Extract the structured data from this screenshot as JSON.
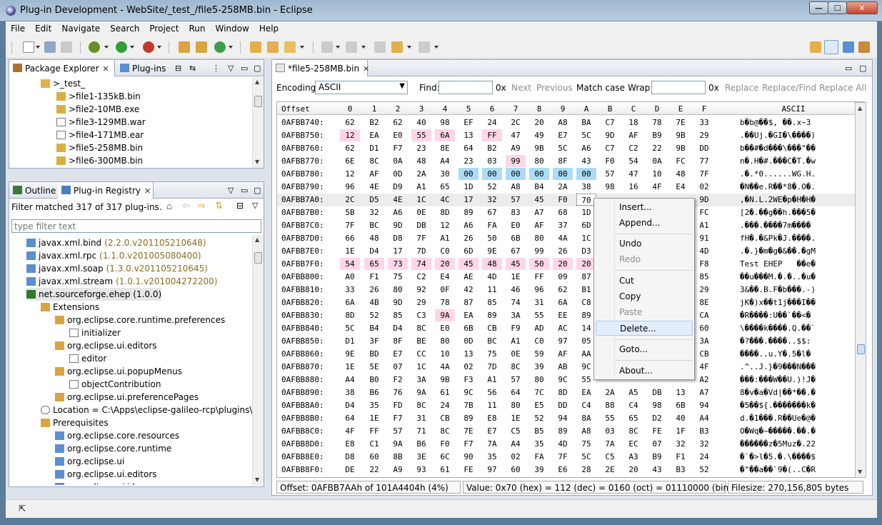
{
  "window": {
    "title": "Plug-in Development - WebSite/_test_/file5-258MB.bin - Eclipse",
    "min": "—",
    "max": "☐",
    "close": "✕"
  },
  "menu": [
    "File",
    "Edit",
    "Navigate",
    "Search",
    "Project",
    "Run",
    "Window",
    "Help"
  ],
  "left_top": {
    "tabs": [
      {
        "label": "Package Explorer",
        "close": "✕"
      },
      {
        "label": "Plug-ins"
      }
    ],
    "tree": [
      {
        "label": ">_test_",
        "indent": 44,
        "icon": "folder"
      },
      {
        "label": ">file1-135kB.bin",
        "indent": 66,
        "icon": "bin"
      },
      {
        "label": ">file2-10MB.exe",
        "indent": 66,
        "icon": "bin"
      },
      {
        "label": ">file3-129MB.war",
        "indent": 66,
        "icon": "file"
      },
      {
        "label": ">file4-171MB.ear",
        "indent": 66,
        "icon": "file"
      },
      {
        "label": ">file5-258MB.bin",
        "indent": 66,
        "icon": "bin"
      },
      {
        "label": ">file6-300MB.bin",
        "indent": 66,
        "icon": "bin"
      }
    ]
  },
  "left_bottom": {
    "tabs": [
      {
        "label": "Outline"
      },
      {
        "label": "Plug-in Registry",
        "close": "✕"
      }
    ],
    "filter_status": "Filter matched 317 of 317 plug-ins.",
    "filter_placeholder": "type filter text",
    "tree": [
      {
        "label": "javax.xml.bind",
        "ver": "(2.2.0.v201105210648)",
        "indent": 24,
        "icon": "plugin"
      },
      {
        "label": "javax.xml.rpc",
        "ver": "(1.1.0.v201005080400)",
        "indent": 24,
        "icon": "plugin"
      },
      {
        "label": "javax.xml.soap",
        "ver": "(1.3.0.v201105210645)",
        "indent": 24,
        "icon": "plugin"
      },
      {
        "label": "javax.xml.stream",
        "ver": "(1.0.1.v201004272200)",
        "indent": 24,
        "icon": "plugin"
      },
      {
        "label": "net.sourceforge.ehep (1.0.0)",
        "ver": "",
        "indent": 24,
        "icon": "plugin-active"
      },
      {
        "label": "Extensions",
        "ver": "",
        "indent": 44,
        "icon": "ext"
      },
      {
        "label": "org.eclipse.core.runtime.preferences",
        "ver": "",
        "indent": 64,
        "icon": "ext"
      },
      {
        "label": "initializer",
        "ver": "",
        "indent": 84,
        "icon": "x"
      },
      {
        "label": "org.eclipse.ui.editors",
        "ver": "",
        "indent": 64,
        "icon": "ext"
      },
      {
        "label": "editor",
        "ver": "",
        "indent": 84,
        "icon": "x"
      },
      {
        "label": "org.eclipse.ui.popupMenus",
        "ver": "",
        "indent": 64,
        "icon": "ext"
      },
      {
        "label": "objectContribution",
        "ver": "",
        "indent": 84,
        "icon": "x"
      },
      {
        "label": "org.eclipse.ui.preferencePages",
        "ver": "",
        "indent": 64,
        "icon": "ext"
      },
      {
        "label": "Location = C:\\Apps\\eclipse-galileo-rcp\\plugins\\net.s",
        "ver": "",
        "indent": 44,
        "icon": "at"
      },
      {
        "label": "Prerequisites",
        "ver": "",
        "indent": 44,
        "icon": "ext"
      },
      {
        "label": "org.eclipse.core.resources",
        "ver": "",
        "indent": 64,
        "icon": "plugin"
      },
      {
        "label": "org.eclipse.core.runtime",
        "ver": "",
        "indent": 64,
        "icon": "plugin"
      },
      {
        "label": "org.eclipse.ui",
        "ver": "",
        "indent": 64,
        "icon": "plugin"
      },
      {
        "label": "org.eclipse.ui.editors",
        "ver": "",
        "indent": 64,
        "icon": "plugin"
      },
      {
        "label": "org.eclipse.ui.ide",
        "ver": "",
        "indent": 64,
        "icon": "plugin"
      }
    ]
  },
  "editor": {
    "tab": {
      "label": "*file5-258MB.bin",
      "close": "✕"
    },
    "encoding_label": "Encoding:",
    "encoding_value": "ASCII",
    "find_label": "Find:",
    "ox1": "0x",
    "next": "Next",
    "previous": "Previous",
    "match_case": "Match case",
    "wrap": "Wrap",
    "ox2": "0x",
    "replace": "Replace",
    "replace_find": "Replace/Find",
    "replace_all": "Replace All",
    "header": [
      "Offset",
      "0",
      "1",
      "2",
      "3",
      "4",
      "5",
      "6",
      "7",
      "8",
      "9",
      "A",
      "B",
      "C",
      "D",
      "E",
      "F",
      "ASCII"
    ],
    "rows": [
      {
        "off": "0AFBB740:",
        "bytes": [
          "62",
          "B2",
          "62",
          "40",
          "98",
          "EF",
          "24",
          "2C",
          "20",
          "A8",
          "BA",
          "C7",
          "18",
          "78",
          "7E",
          "33"
        ],
        "ascii": "b�b@��$, ��.x~3"
      },
      {
        "off": "0AFBB750:",
        "bytes": [
          "12",
          "EA",
          "E0",
          "55",
          "6A",
          "13",
          "FF",
          "47",
          "49",
          "E7",
          "5C",
          "9D",
          "AF",
          "B9",
          "9B",
          "29"
        ],
        "ascii": ".��Uj.�GI�\\����)"
      },
      {
        "off": "0AFBB760:",
        "bytes": [
          "62",
          "D1",
          "F7",
          "23",
          "8E",
          "64",
          "B2",
          "A9",
          "9B",
          "5C",
          "A6",
          "C7",
          "C2",
          "22",
          "9B",
          "DD"
        ],
        "ascii": "b��#�d���\\���\"��"
      },
      {
        "off": "0AFBB770:",
        "bytes": [
          "6E",
          "8C",
          "0A",
          "48",
          "A4",
          "23",
          "03",
          "99",
          "80",
          "8F",
          "43",
          "F0",
          "54",
          "0A",
          "FC",
          "77"
        ],
        "ascii": "n�.H�#.���C�T.�w"
      },
      {
        "off": "0AFBB780:",
        "bytes": [
          "12",
          "AF",
          "0D",
          "2A",
          "30",
          "00",
          "00",
          "00",
          "00",
          "00",
          "00",
          "57",
          "47",
          "10",
          "48",
          "7F"
        ],
        "ascii": ".�.*0......WG.H."
      },
      {
        "off": "0AFBB790:",
        "bytes": [
          "96",
          "4E",
          "D9",
          "A1",
          "65",
          "1D",
          "52",
          "A8",
          "B4",
          "2A",
          "38",
          "98",
          "16",
          "4F",
          "E4",
          "02"
        ],
        "ascii": "�N��e.R��*8�.O�."
      },
      {
        "off": "0AFBB7A0:",
        "bytes": [
          "2C",
          "D5",
          "4E",
          "1C",
          "4C",
          "17",
          "32",
          "57",
          "45",
          "F0",
          "70",
          "",
          "",
          "",
          "",
          "9D"
        ],
        "ascii": ",�N.L.2WE�p�H�H�"
      },
      {
        "off": "0AFBB7B0:",
        "bytes": [
          "5B",
          "32",
          "A6",
          "0E",
          "8D",
          "89",
          "67",
          "83",
          "A7",
          "68",
          "1D",
          "",
          "",
          "",
          "",
          "FC"
        ],
        "ascii": "[2�.��g��h.���5�"
      },
      {
        "off": "0AFBB7C0:",
        "bytes": [
          "7F",
          "BC",
          "9D",
          "DB",
          "12",
          "A6",
          "FA",
          "E0",
          "AF",
          "37",
          "6D",
          "",
          "",
          "",
          "",
          "A1"
        ],
        "ascii": ".���.����7m����"
      },
      {
        "off": "0AFBB7D0:",
        "bytes": [
          "66",
          "48",
          "D8",
          "7F",
          "A1",
          "26",
          "50",
          "6B",
          "80",
          "4A",
          "1C",
          "",
          "",
          "",
          "",
          "91"
        ],
        "ascii": "fH�.�&Pk�J.����."
      },
      {
        "off": "0AFBB7E0:",
        "bytes": [
          "1E",
          "D4",
          "17",
          "7D",
          "C0",
          "6D",
          "9E",
          "67",
          "99",
          "26",
          "D3",
          "",
          "",
          "",
          "",
          "4D"
        ],
        "ascii": ".�.}�m�g�&��.�gM"
      },
      {
        "off": "0AFBB7F0:",
        "bytes": [
          "54",
          "65",
          "73",
          "74",
          "20",
          "45",
          "48",
          "45",
          "50",
          "20",
          "20",
          "",
          "",
          "",
          "",
          "F8"
        ],
        "ascii": "Test EHEP   ��e�"
      },
      {
        "off": "0AFBB800:",
        "bytes": [
          "A0",
          "F1",
          "75",
          "C2",
          "E4",
          "AE",
          "4D",
          "1E",
          "FF",
          "09",
          "87",
          "",
          "",
          "",
          "",
          "85"
        ],
        "ascii": "��u���M.�.�..�u�"
      },
      {
        "off": "0AFBB810:",
        "bytes": [
          "33",
          "26",
          "80",
          "92",
          "0F",
          "42",
          "11",
          "46",
          "96",
          "62",
          "B1",
          "",
          "",
          "",
          "",
          "29"
        ],
        "ascii": "3&��.B.F�b���.-)"
      },
      {
        "off": "0AFBB820:",
        "bytes": [
          "6A",
          "4B",
          "9D",
          "29",
          "78",
          "87",
          "85",
          "74",
          "31",
          "6A",
          "C8",
          "",
          "",
          "",
          "",
          "8E"
        ],
        "ascii": "jK�)x��t1j���I��"
      },
      {
        "off": "0AFBB830:",
        "bytes": [
          "8D",
          "52",
          "85",
          "C3",
          "9A",
          "EA",
          "89",
          "3A",
          "55",
          "EE",
          "89",
          "",
          "",
          "",
          "",
          "CA"
        ],
        "ascii": "�R����:U��`��<�"
      },
      {
        "off": "0AFBB840:",
        "bytes": [
          "5C",
          "B4",
          "D4",
          "8C",
          "E0",
          "6B",
          "CB",
          "F9",
          "AD",
          "AC",
          "14",
          "",
          "",
          "",
          "",
          "60"
        ],
        "ascii": "\\����k����.Q.��`"
      },
      {
        "off": "0AFBB850:",
        "bytes": [
          "D1",
          "3F",
          "8F",
          "BE",
          "80",
          "0D",
          "BC",
          "A1",
          "C0",
          "97",
          "05",
          "",
          "",
          "",
          "",
          "3A"
        ],
        "ascii": "�?���.����..$$:"
      },
      {
        "off": "0AFBB860:",
        "bytes": [
          "9E",
          "BD",
          "E7",
          "CC",
          "10",
          "13",
          "75",
          "0E",
          "59",
          "AF",
          "AA",
          "",
          "",
          "",
          "",
          "CB"
        ],
        "ascii": "����..u.Y�.5�l�"
      },
      {
        "off": "0AFBB870:",
        "bytes": [
          "1E",
          "5E",
          "07",
          "1C",
          "4A",
          "02",
          "7D",
          "8C",
          "39",
          "AB",
          "9C",
          "",
          "",
          "",
          "",
          "4F"
        ],
        "ascii": ".^..J.}�9���N���"
      },
      {
        "off": "0AFBB880:",
        "bytes": [
          "A4",
          "B0",
          "F2",
          "3A",
          "9B",
          "F3",
          "A1",
          "57",
          "80",
          "9C",
          "55",
          "",
          "",
          "",
          "",
          "A2"
        ],
        "ascii": "���:���W��U.)!J�"
      },
      {
        "off": "0AFBB890:",
        "bytes": [
          "38",
          "B6",
          "76",
          "9A",
          "61",
          "9C",
          "56",
          "64",
          "7C",
          "8D",
          "EA",
          "2A",
          "A5",
          "DB",
          "13",
          "A7"
        ],
        "ascii": "8�v�a�Vd|��*��.�"
      },
      {
        "off": "0AFBB8A0:",
        "bytes": [
          "D4",
          "35",
          "FD",
          "8C",
          "24",
          "7B",
          "11",
          "80",
          "E5",
          "DD",
          "C4",
          "88",
          "C4",
          "98",
          "6B",
          "94"
        ],
        "ascii": "�5��${.�������k�"
      },
      {
        "off": "0AFBB8B0:",
        "bytes": [
          "64",
          "1E",
          "F7",
          "31",
          "CB",
          "89",
          "E8",
          "1E",
          "52",
          "94",
          "8A",
          "55",
          "65",
          "D2",
          "40",
          "A4"
        ],
        "ascii": "d.�1���.R��Ue�@�"
      },
      {
        "off": "0AFBB8C0:",
        "bytes": [
          "4F",
          "FF",
          "57",
          "71",
          "8C",
          "7E",
          "E7",
          "C5",
          "B5",
          "89",
          "A8",
          "03",
          "8C",
          "FE",
          "1F",
          "B3"
        ],
        "ascii": "O�Wq�~�����.��.�"
      },
      {
        "off": "0AFBB8D0:",
        "bytes": [
          "E8",
          "C1",
          "9A",
          "B6",
          "F0",
          "F7",
          "7A",
          "A4",
          "35",
          "4D",
          "75",
          "7A",
          "EC",
          "07",
          "32",
          "32"
        ],
        "ascii": "������z�5Muz�.22"
      },
      {
        "off": "0AFBB8E0:",
        "bytes": [
          "D8",
          "60",
          "8B",
          "3E",
          "6C",
          "90",
          "35",
          "02",
          "FA",
          "7F",
          "5C",
          "C5",
          "A3",
          "B9",
          "F1",
          "24"
        ],
        "ascii": "�`�>l�5.�.\\����$"
      },
      {
        "off": "0AFBB8F0:",
        "bytes": [
          "DE",
          "22",
          "A9",
          "93",
          "61",
          "FE",
          "97",
          "60",
          "39",
          "E6",
          "28",
          "2E",
          "20",
          "43",
          "B3",
          "52"
        ],
        "ascii": "�\"��a��`9�(..C�R"
      }
    ],
    "status_offset": "Offset: 0AFBB7AAh of 101A4404h (4%)",
    "status_value": "Value: 0x70 (hex) = 112 (dec) = 0160 (oct) = 01110000 (bin)",
    "status_filesize": "Filesize: 270,156,805 bytes"
  },
  "context_menu": [
    "Insert...",
    "Append...",
    "Undo",
    "Redo",
    "Cut",
    "Copy",
    "Paste",
    "Delete...",
    "Goto...",
    "About..."
  ]
}
